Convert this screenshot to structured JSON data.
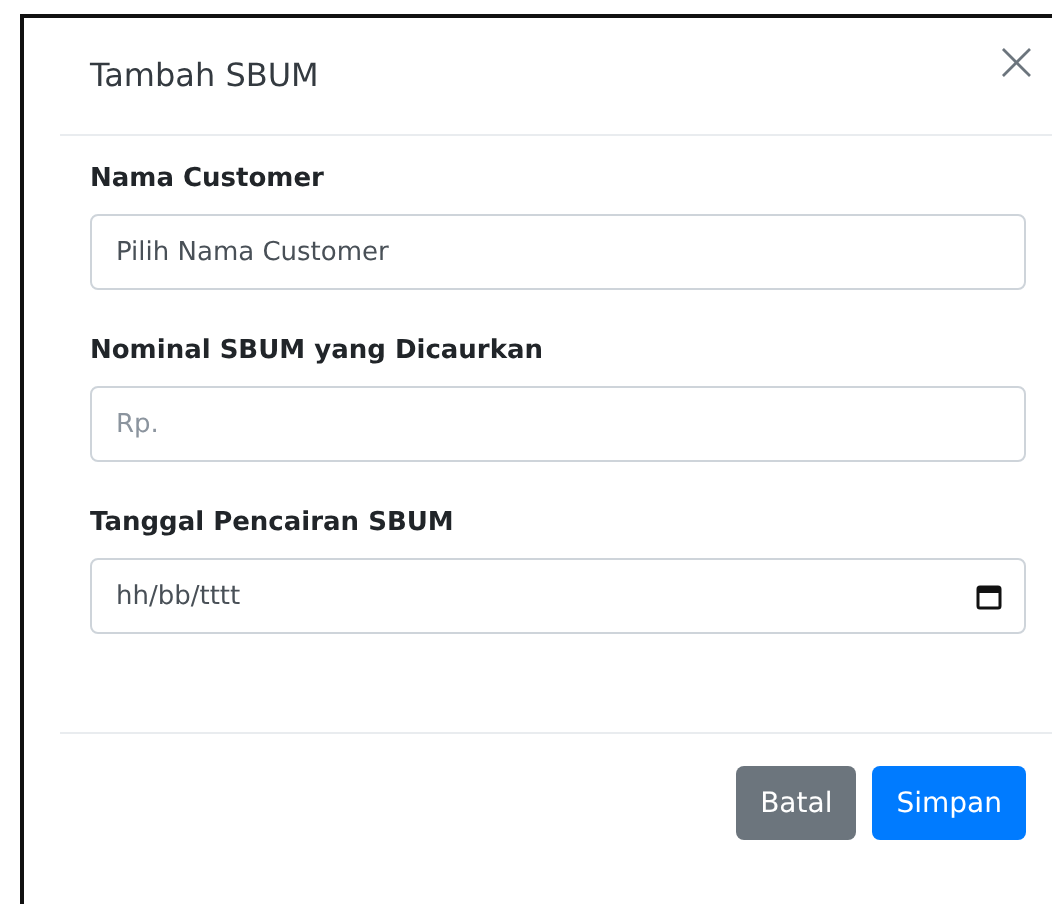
{
  "modal": {
    "title": "Tambah SBUM",
    "close_label": "×"
  },
  "fields": [
    {
      "label": "Nama Customer",
      "kind": "select",
      "value": "Pilih Nama Customer"
    },
    {
      "label": "Nominal SBUM yang Dicaurkan",
      "kind": "text",
      "placeholder": "Rp."
    },
    {
      "label": "Tanggal Pencairan SBUM",
      "kind": "date",
      "value": "hh/bb/tttt"
    }
  ],
  "buttons": [
    {
      "label": "Batal",
      "kind": "secondary"
    },
    {
      "label": "Simpan",
      "kind": "primary"
    }
  ]
}
